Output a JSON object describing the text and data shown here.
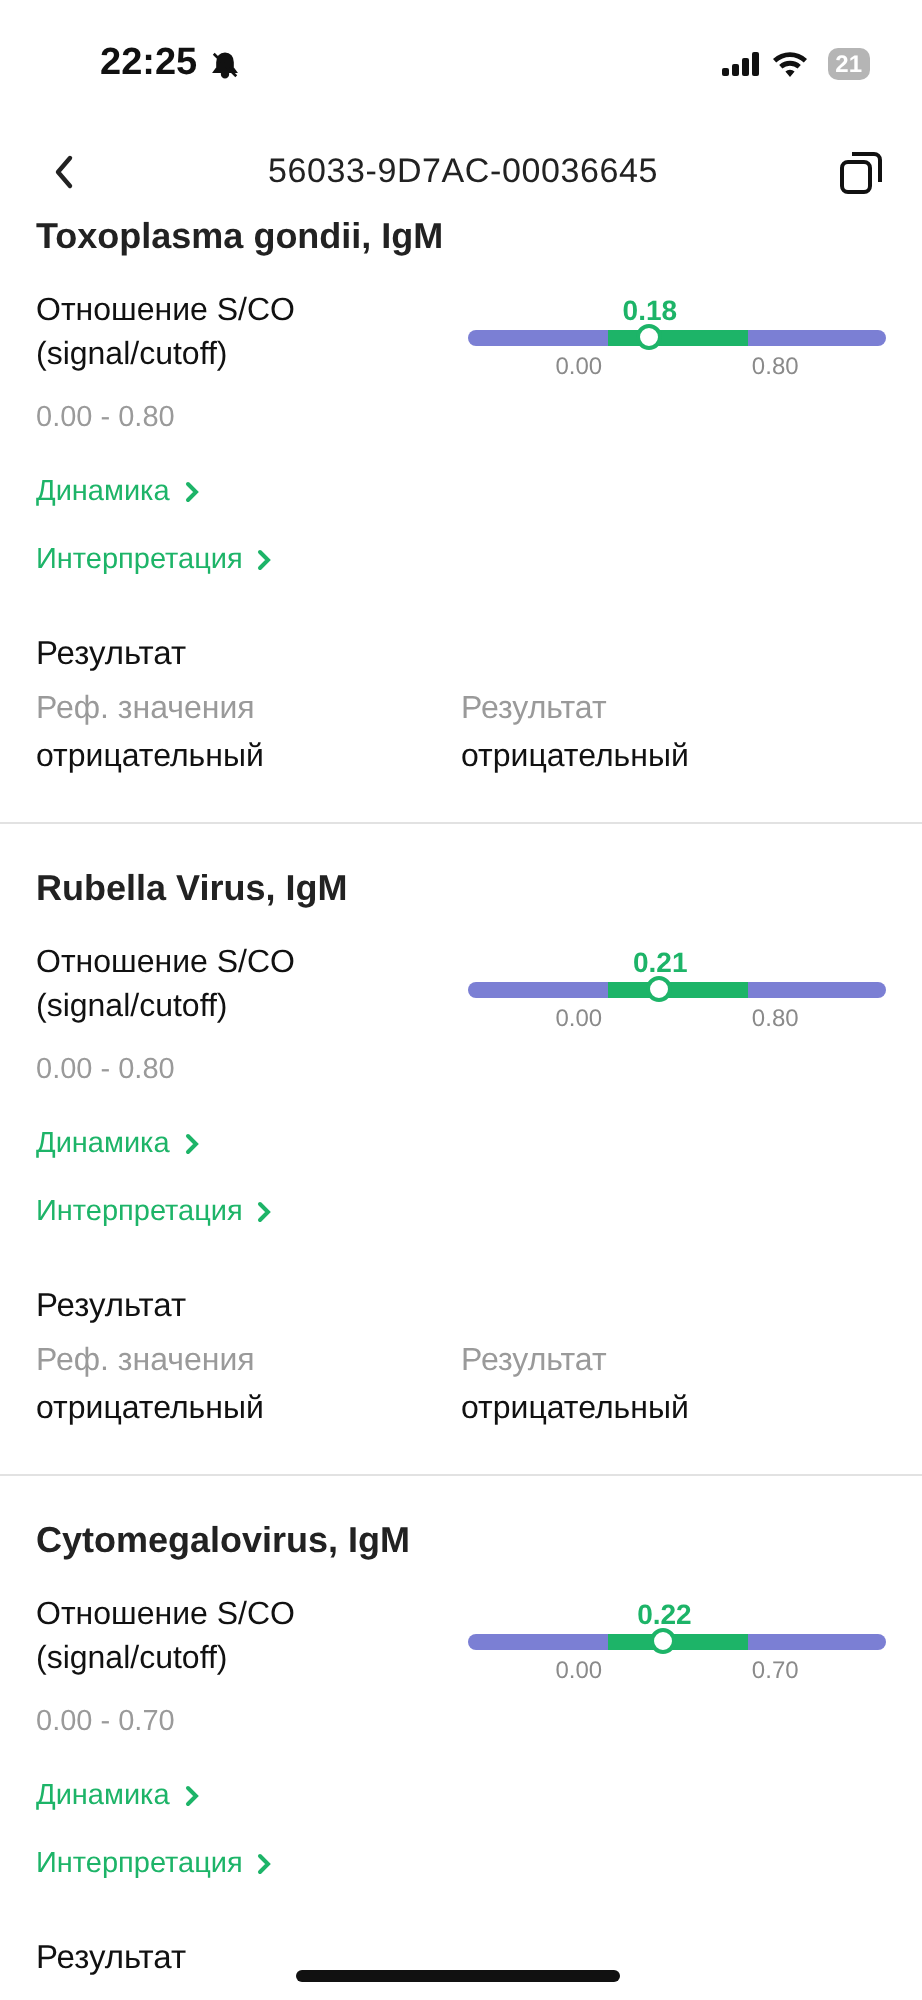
{
  "status_bar": {
    "time": "22:25",
    "battery": "21"
  },
  "nav": {
    "title": "56033-9D7AC-00036645"
  },
  "sections": [
    {
      "title": "Toxoplasma gondii, IgM",
      "metric": "Отношение S/CO (signal/cutoff)",
      "range": "0.00 - 0.80",
      "value": "0.18",
      "level": 0.435,
      "low": "0.00",
      "high": "0.80",
      "links": [
        "Динамика",
        "Интерпретация"
      ],
      "result_heading": "Результат",
      "result_columns": [
        {
          "label": "Реф. значения",
          "value": "отрицательный"
        },
        {
          "label": "Результат",
          "value": "отрицательный"
        }
      ]
    },
    {
      "title": "Rubella Virus, IgM",
      "metric": "Отношение S/CO (signal/cutoff)",
      "range": "0.00 - 0.80",
      "value": "0.21",
      "level": 0.46,
      "low": "0.00",
      "high": "0.80",
      "links": [
        "Динамика",
        "Интерпретация"
      ],
      "result_heading": "Результат",
      "result_columns": [
        {
          "label": "Реф. значения",
          "value": "отрицательный"
        },
        {
          "label": "Результат",
          "value": "отрицательный"
        }
      ]
    },
    {
      "title": "Cytomegalovirus, IgM",
      "metric": "Отношение S/CO (signal/cutoff)",
      "range": "0.00 - 0.70",
      "value": "0.22",
      "level": 0.47,
      "low": "0.00",
      "high": "0.70",
      "links": [
        "Динамика",
        "Интерпретация"
      ],
      "result_heading": "Результат"
    }
  ]
}
